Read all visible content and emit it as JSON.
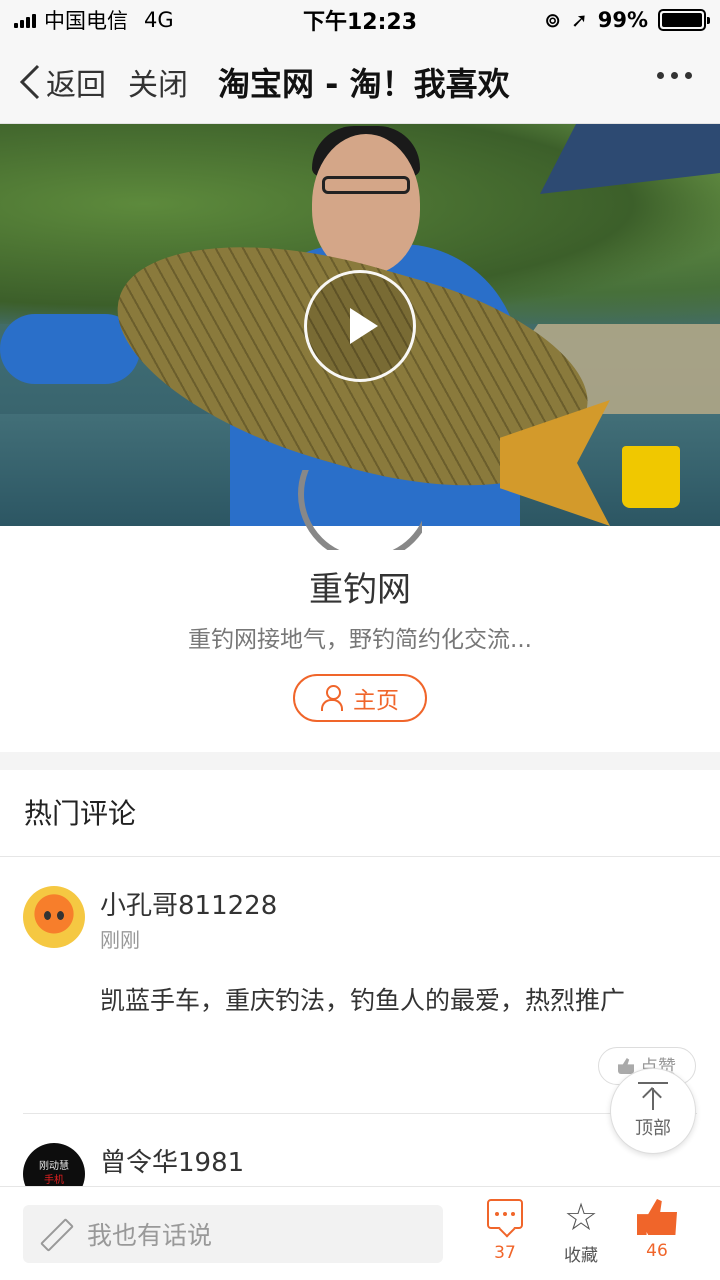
{
  "status_bar": {
    "carrier": "中国电信",
    "network": "4G",
    "time": "下午12:23",
    "battery": "99%",
    "battery_level": 0.99
  },
  "nav": {
    "back_label": "返回",
    "close_label": "关闭",
    "title": "淘宝网 - 淘！我喜欢"
  },
  "video": {
    "play_icon": "play-icon"
  },
  "author": {
    "name": "重钓网",
    "description": "重钓网接地气，野钓简约化交流...",
    "home_label": "主页"
  },
  "comments_section": {
    "title": "热门评论",
    "comments": [
      {
        "user": "小孔哥811228",
        "time": "刚刚",
        "text": "凯蓝手车，重庆钓法，钓鱼人的最爱，热烈推广",
        "like_label": "点赞"
      },
      {
        "user": "曾令华1981",
        "avatar_text": [
          "刚动慧",
          "手机"
        ]
      }
    ],
    "top_label": "顶部"
  },
  "bottom_bar": {
    "input_placeholder": "我也有话说",
    "comment_count": "37",
    "favorite_label": "收藏",
    "like_count": "46"
  },
  "colors": {
    "accent": "#f0652a",
    "background": "#ffffff",
    "nav_background": "#f7f7f7"
  }
}
